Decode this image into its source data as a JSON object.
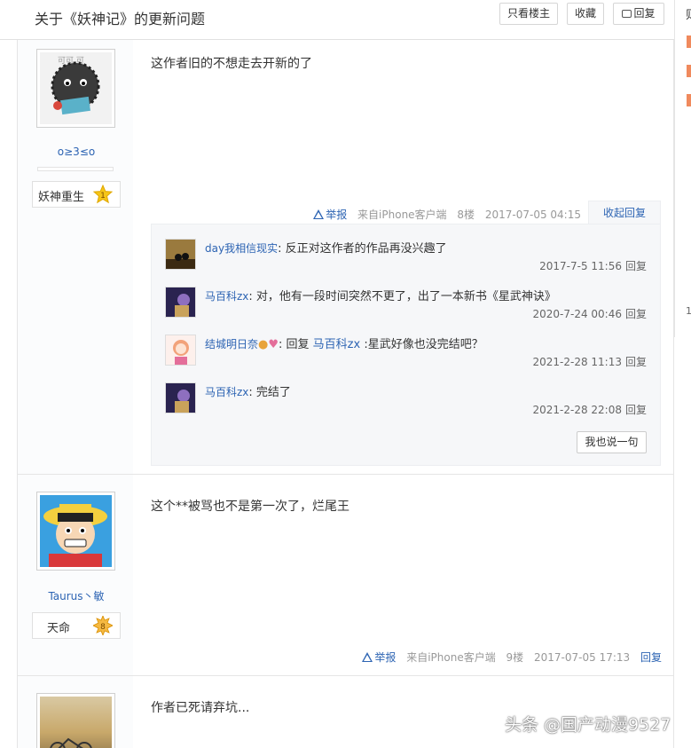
{
  "header": {
    "title": "关于《妖神记》的更新问题",
    "only_host": "只看楼主",
    "favorite": "收藏",
    "reply": "回复"
  },
  "right_edge": {
    "char": "则",
    "number": "1"
  },
  "posts": [
    {
      "username": "o≥3≤o",
      "badge_name": "妖神重生",
      "badge_level": "1",
      "content": "这作者旧的不想走去开新的了",
      "report": "举报",
      "source": "来自iPhone客户端",
      "floor": "8楼",
      "time": "2017-07-05 04:15",
      "collapse": "收起回复",
      "sub_replies": [
        {
          "user": "day我相信现实",
          "colon": ":",
          "text": " 反正对这作者的作品再没兴趣了",
          "time": "2017-7-5 11:56",
          "reply": "回复"
        },
        {
          "user": "马百科zx",
          "colon": ":",
          "text": " 对，他有一段时间突然不更了，出了一本新书《星武神诀》",
          "time": "2020-7-24 00:46",
          "reply": "回复"
        },
        {
          "user": "结城明日奈",
          "colon": ":",
          "prefix": " 回复 ",
          "target": "马百科zx",
          "text": " :星武好像也没完结吧？",
          "time": "2021-2-28 11:13",
          "reply": "回复"
        },
        {
          "user": "马百科zx",
          "colon": ":",
          "text": " 完结了",
          "time": "2021-2-28 22:08",
          "reply": "回复"
        }
      ],
      "say_button": "我也说一句"
    },
    {
      "username": "Taurus丶敏",
      "badge_name": "天命",
      "badge_level": "8",
      "content": "这个**被骂也不是第一次了，烂尾王",
      "report": "举报",
      "source": "来自iPhone客户端",
      "floor": "9楼",
      "time": "2017-07-05 17:13",
      "reply": "回复"
    },
    {
      "content": "作者已死请弃坑..."
    }
  ],
  "watermark": "头条 @国产动漫9527",
  "colors": {
    "link": "#2d64b3",
    "star": "#f5c518",
    "accent": "#f08a5d"
  }
}
